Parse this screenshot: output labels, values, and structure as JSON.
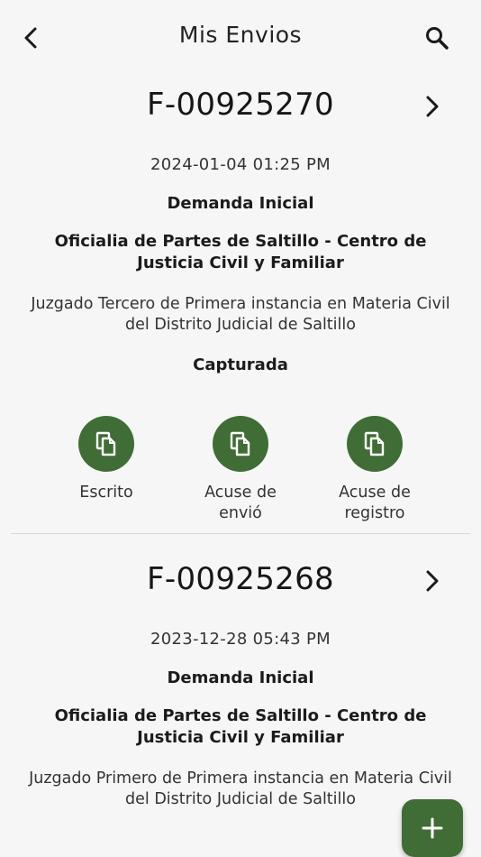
{
  "header": {
    "title": "Mis Envios",
    "back_icon": "arrow-back-icon",
    "search_icon": "search-icon"
  },
  "envios": [
    {
      "folio": "F-00925270",
      "date": "2024-01-04 01:25 PM",
      "kind": "Demanda Inicial",
      "office": "Oficialia de Partes de Saltillo - Centro de Justicia Civil y Familiar",
      "court": "Juzgado Tercero de Primera instancia en Materia Civil del Distrito Judicial de Saltillo",
      "status": "Capturada",
      "actions": [
        {
          "label": "Escrito",
          "icon": "copy-document-icon"
        },
        {
          "label": "Acuse de envió",
          "icon": "copy-document-icon"
        },
        {
          "label": "Acuse de registro",
          "icon": "copy-document-icon"
        }
      ]
    },
    {
      "folio": "F-00925268",
      "date": "2023-12-28 05:43 PM",
      "kind": "Demanda Inicial",
      "office": "Oficialia de Partes de Saltillo - Centro de Justicia Civil y Familiar",
      "court": "Juzgado Primero de Primera instancia en Materia Civil del Distrito Judicial de Saltillo"
    }
  ],
  "fab": {
    "icon": "plus-icon"
  },
  "colors": {
    "accent": "#3f6d35",
    "background": "#f6f6f6"
  }
}
